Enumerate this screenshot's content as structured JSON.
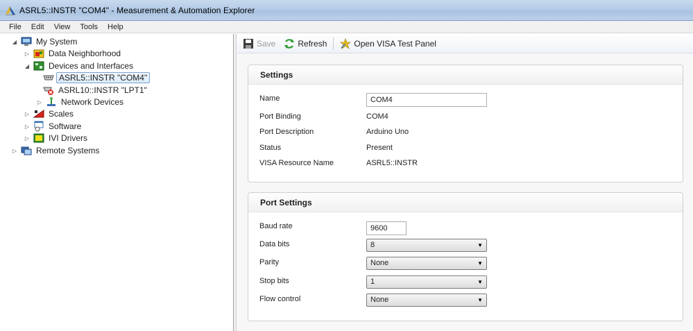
{
  "window": {
    "title": "ASRL5::INSTR \"COM4\" - Measurement & Automation Explorer"
  },
  "menu": [
    "File",
    "Edit",
    "View",
    "Tools",
    "Help"
  ],
  "tree": {
    "items": [
      {
        "label": "My System",
        "expanded": true
      },
      {
        "label": "Data Neighborhood",
        "expanded": false
      },
      {
        "label": "Devices and Interfaces",
        "expanded": true
      },
      {
        "label": "ASRL5::INSTR \"COM4\"",
        "selected": true
      },
      {
        "label": "ASRL10::INSTR \"LPT1\""
      },
      {
        "label": "Network Devices",
        "expanded": false
      },
      {
        "label": "Scales",
        "expanded": false
      },
      {
        "label": "Software",
        "expanded": false
      },
      {
        "label": "IVI Drivers",
        "expanded": false
      },
      {
        "label": "Remote Systems",
        "expanded": false
      }
    ]
  },
  "toolbar": {
    "save_label": "Save",
    "refresh_label": "Refresh",
    "visa_label": "Open VISA Test Panel"
  },
  "settings": {
    "title": "Settings",
    "name_label": "Name",
    "name_value": "COM4",
    "port_binding_label": "Port Binding",
    "port_binding_value": "COM4",
    "port_description_label": "Port Description",
    "port_description_value": "Arduino Uno",
    "status_label": "Status",
    "status_value": "Present",
    "visa_name_label": "VISA Resource Name",
    "visa_name_value": "ASRL5::INSTR"
  },
  "port_settings": {
    "title": "Port Settings",
    "baud_label": "Baud rate",
    "baud_value": "9600",
    "data_bits_label": "Data bits",
    "data_bits_value": "8",
    "parity_label": "Parity",
    "parity_value": "None",
    "stop_bits_label": "Stop bits",
    "stop_bits_value": "1",
    "flow_label": "Flow control",
    "flow_value": "None"
  },
  "colors": {
    "selection_border": "#7da2ce",
    "titlebar": "#b6cde8",
    "refresh_green": "#2e9b2e"
  }
}
